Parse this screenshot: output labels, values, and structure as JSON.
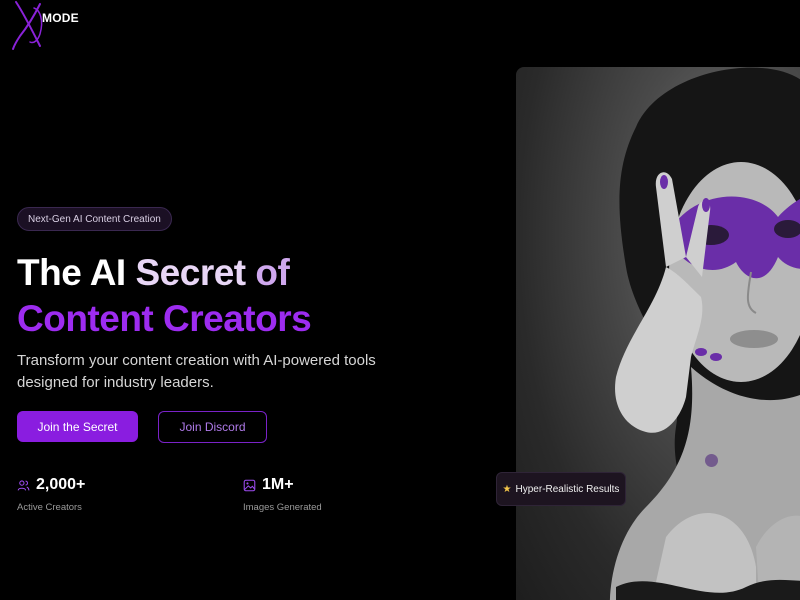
{
  "brand": {
    "logo_letter": "X",
    "logo_text": "MODE",
    "accent": "#9d2cf0"
  },
  "hero": {
    "badge": "Next-Gen AI Content Creation",
    "headline_line1": [
      "The",
      "AI",
      "Secret",
      "of"
    ],
    "headline_line2": "Content Creators",
    "subtitle": "Transform your content creation with AI-powered tools designed for industry leaders.",
    "primary_button": "Join the Secret",
    "secondary_button": "Join Discord"
  },
  "stats": [
    {
      "icon": "users-icon",
      "value": "2,000+",
      "label": "Active Creators"
    },
    {
      "icon": "image-icon",
      "value": "1M+",
      "label": "Images Generated"
    }
  ],
  "image_card": {
    "badge_icon": "star-icon",
    "badge_text": "Hyper-Realistic Results"
  }
}
